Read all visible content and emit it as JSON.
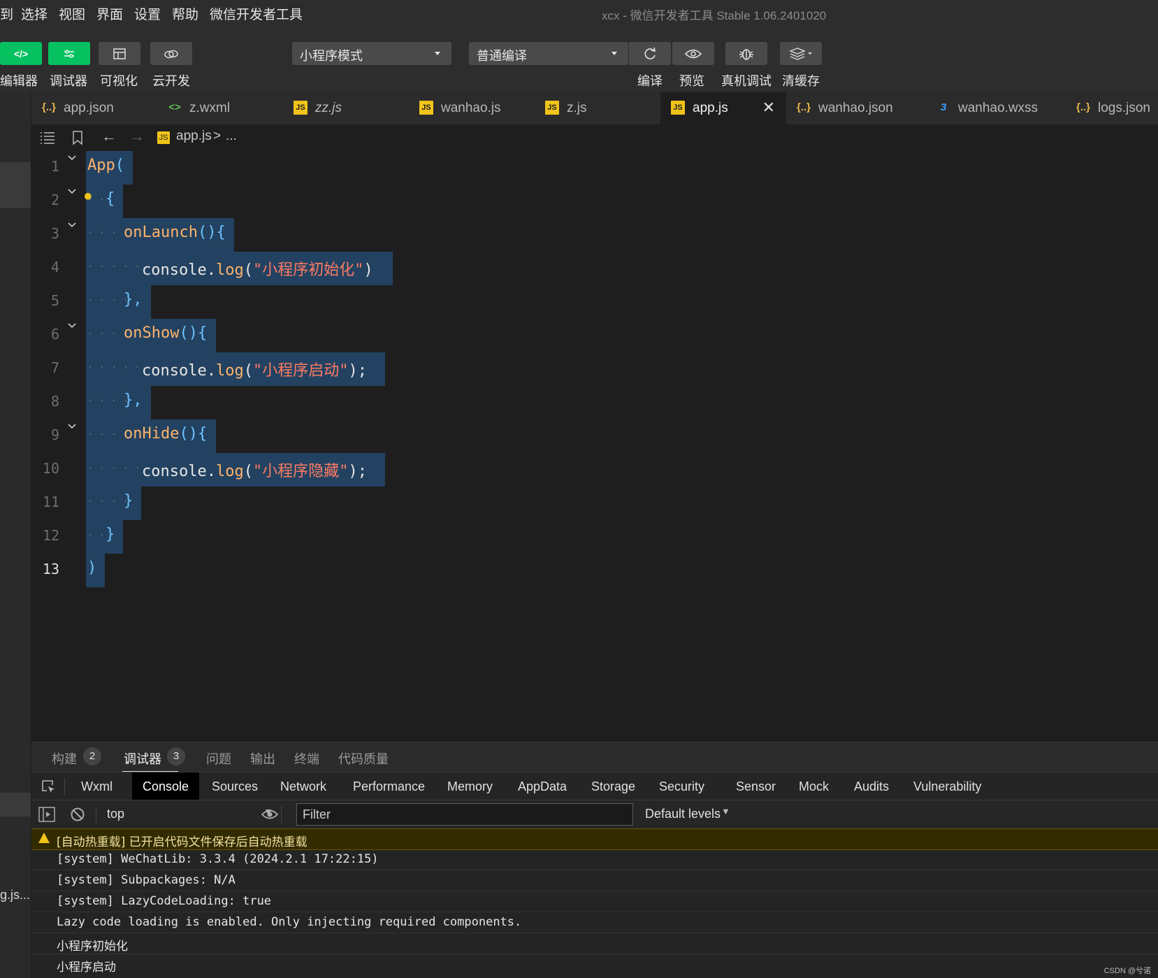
{
  "menu": {
    "items": [
      "到",
      "选择",
      "视图",
      "界面",
      "设置",
      "帮助",
      "微信开发者工具"
    ],
    "window_title": "xcx - 微信开发者工具 Stable 1.06.2401020"
  },
  "toolbar": {
    "left_buttons": [
      {
        "label": "编辑器",
        "icon": "code-icon"
      },
      {
        "label": "调试器",
        "icon": "debug-sliders-icon"
      },
      {
        "label": "可视化",
        "icon": "layout-icon"
      },
      {
        "label": "云开发",
        "icon": "cloud-icon"
      }
    ],
    "mode_select": "小程序模式",
    "compile_select": "普通编译",
    "right_buttons": [
      {
        "label": "编译",
        "icon": "refresh-icon"
      },
      {
        "label": "预览",
        "icon": "eye-icon"
      },
      {
        "label": "真机调试",
        "icon": "bug-icon"
      },
      {
        "label": "清缓存",
        "icon": "layers-icon"
      }
    ]
  },
  "tabs": [
    {
      "label": "app.json",
      "icon": "json-icon",
      "glyph": "{..}",
      "active": false
    },
    {
      "label": "z.wxml",
      "icon": "wxml-icon",
      "glyph": "<>",
      "active": false
    },
    {
      "label": "zz.js",
      "icon": "js-icon",
      "glyph": "JS",
      "active": false
    },
    {
      "label": "wanhao.js",
      "icon": "js-icon",
      "glyph": "JS",
      "active": false
    },
    {
      "label": "z.js",
      "icon": "js-icon",
      "glyph": "JS",
      "active": false
    },
    {
      "label": "app.js",
      "icon": "js-icon",
      "glyph": "JS",
      "active": true
    },
    {
      "label": "wanhao.json",
      "icon": "json-icon",
      "glyph": "{..}",
      "active": false
    },
    {
      "label": "wanhao.wxss",
      "icon": "css-icon",
      "glyph": "3",
      "active": false
    },
    {
      "label": "logs.json",
      "icon": "json-icon",
      "glyph": "{..}",
      "active": false
    }
  ],
  "breadcrumb": {
    "file": "app.js",
    "sep": ">",
    "rest": "..."
  },
  "editor": {
    "lines": [
      {
        "n": "1",
        "indent": 0,
        "tokens": [
          [
            "c-fn",
            "App"
          ],
          [
            "c-br",
            "("
          ]
        ]
      },
      {
        "n": "2",
        "indent": 1,
        "tokens": [
          [
            "c-br",
            "{"
          ]
        ]
      },
      {
        "n": "3",
        "indent": 2,
        "tokens": [
          [
            "c-fn",
            "onLaunch"
          ],
          [
            "c-br",
            "(){"
          ]
        ]
      },
      {
        "n": "4",
        "indent": 3,
        "tokens": [
          [
            "c-plain",
            "console."
          ],
          [
            "c-fn",
            "log"
          ],
          [
            "c-plain",
            "("
          ],
          [
            "c-str",
            "\"小程序初始化\""
          ],
          [
            "c-plain",
            ")"
          ]
        ]
      },
      {
        "n": "5",
        "indent": 2,
        "tokens": [
          [
            "c-br",
            "},"
          ]
        ]
      },
      {
        "n": "6",
        "indent": 2,
        "tokens": [
          [
            "c-fn",
            "onShow"
          ],
          [
            "c-br",
            "(){"
          ]
        ]
      },
      {
        "n": "7",
        "indent": 3,
        "tokens": [
          [
            "c-plain",
            "console."
          ],
          [
            "c-fn",
            "log"
          ],
          [
            "c-plain",
            "("
          ],
          [
            "c-str",
            "\"小程序启动\""
          ],
          [
            "c-plain",
            ");"
          ]
        ]
      },
      {
        "n": "8",
        "indent": 2,
        "tokens": [
          [
            "c-br",
            "},"
          ]
        ]
      },
      {
        "n": "9",
        "indent": 2,
        "tokens": [
          [
            "c-fn",
            "onHide"
          ],
          [
            "c-br",
            "(){"
          ]
        ]
      },
      {
        "n": "10",
        "indent": 3,
        "tokens": [
          [
            "c-plain",
            "console."
          ],
          [
            "c-fn",
            "log"
          ],
          [
            "c-plain",
            "("
          ],
          [
            "c-str",
            "\"小程序隐藏\""
          ],
          [
            "c-plain",
            ");"
          ]
        ]
      },
      {
        "n": "11",
        "indent": 2,
        "tokens": [
          [
            "c-br",
            "}"
          ]
        ]
      },
      {
        "n": "12",
        "indent": 1,
        "tokens": [
          [
            "c-br",
            "}"
          ]
        ]
      },
      {
        "n": "13",
        "indent": 0,
        "tokens": [
          [
            "c-br",
            ")"
          ]
        ]
      }
    ]
  },
  "panel": {
    "tabs": [
      {
        "label": "构建",
        "badge": "2",
        "active": false
      },
      {
        "label": "调试器",
        "badge": "3",
        "active": true
      },
      {
        "label": "问题",
        "badge": null,
        "active": false
      },
      {
        "label": "输出",
        "badge": null,
        "active": false
      },
      {
        "label": "终端",
        "badge": null,
        "active": false
      },
      {
        "label": "代码质量",
        "badge": null,
        "active": false
      }
    ]
  },
  "devtools": {
    "tabs": [
      "Wxml",
      "Console",
      "Sources",
      "Network",
      "Performance",
      "Memory",
      "AppData",
      "Storage",
      "Security",
      "Sensor",
      "Mock",
      "Audits",
      "Vulnerability"
    ],
    "active_tab": "Console",
    "context": "top",
    "filter_placeholder": "Filter",
    "levels": "Default levels"
  },
  "console": {
    "rows": [
      {
        "type": "warn",
        "text": "[自动热重载] 已开启代码文件保存后自动热重载"
      },
      {
        "type": "log",
        "text": "[system] WeChatLib: 3.3.4 (2024.2.1 17:22:15)"
      },
      {
        "type": "log",
        "text": "[system] Subpackages: N/A"
      },
      {
        "type": "log",
        "text": "[system] LazyCodeLoading: true"
      },
      {
        "type": "log",
        "text": "Lazy code loading is enabled. Only injecting required components."
      },
      {
        "type": "log",
        "text": "小程序初始化"
      },
      {
        "type": "log",
        "text": "小程序启动"
      }
    ]
  },
  "left_strip_truncated": "g.js...",
  "watermark": "CSDN @兮诺",
  "colors": {
    "accent_green": "#07c160",
    "selection": "#264f78",
    "warning_bg": "#332b00"
  }
}
